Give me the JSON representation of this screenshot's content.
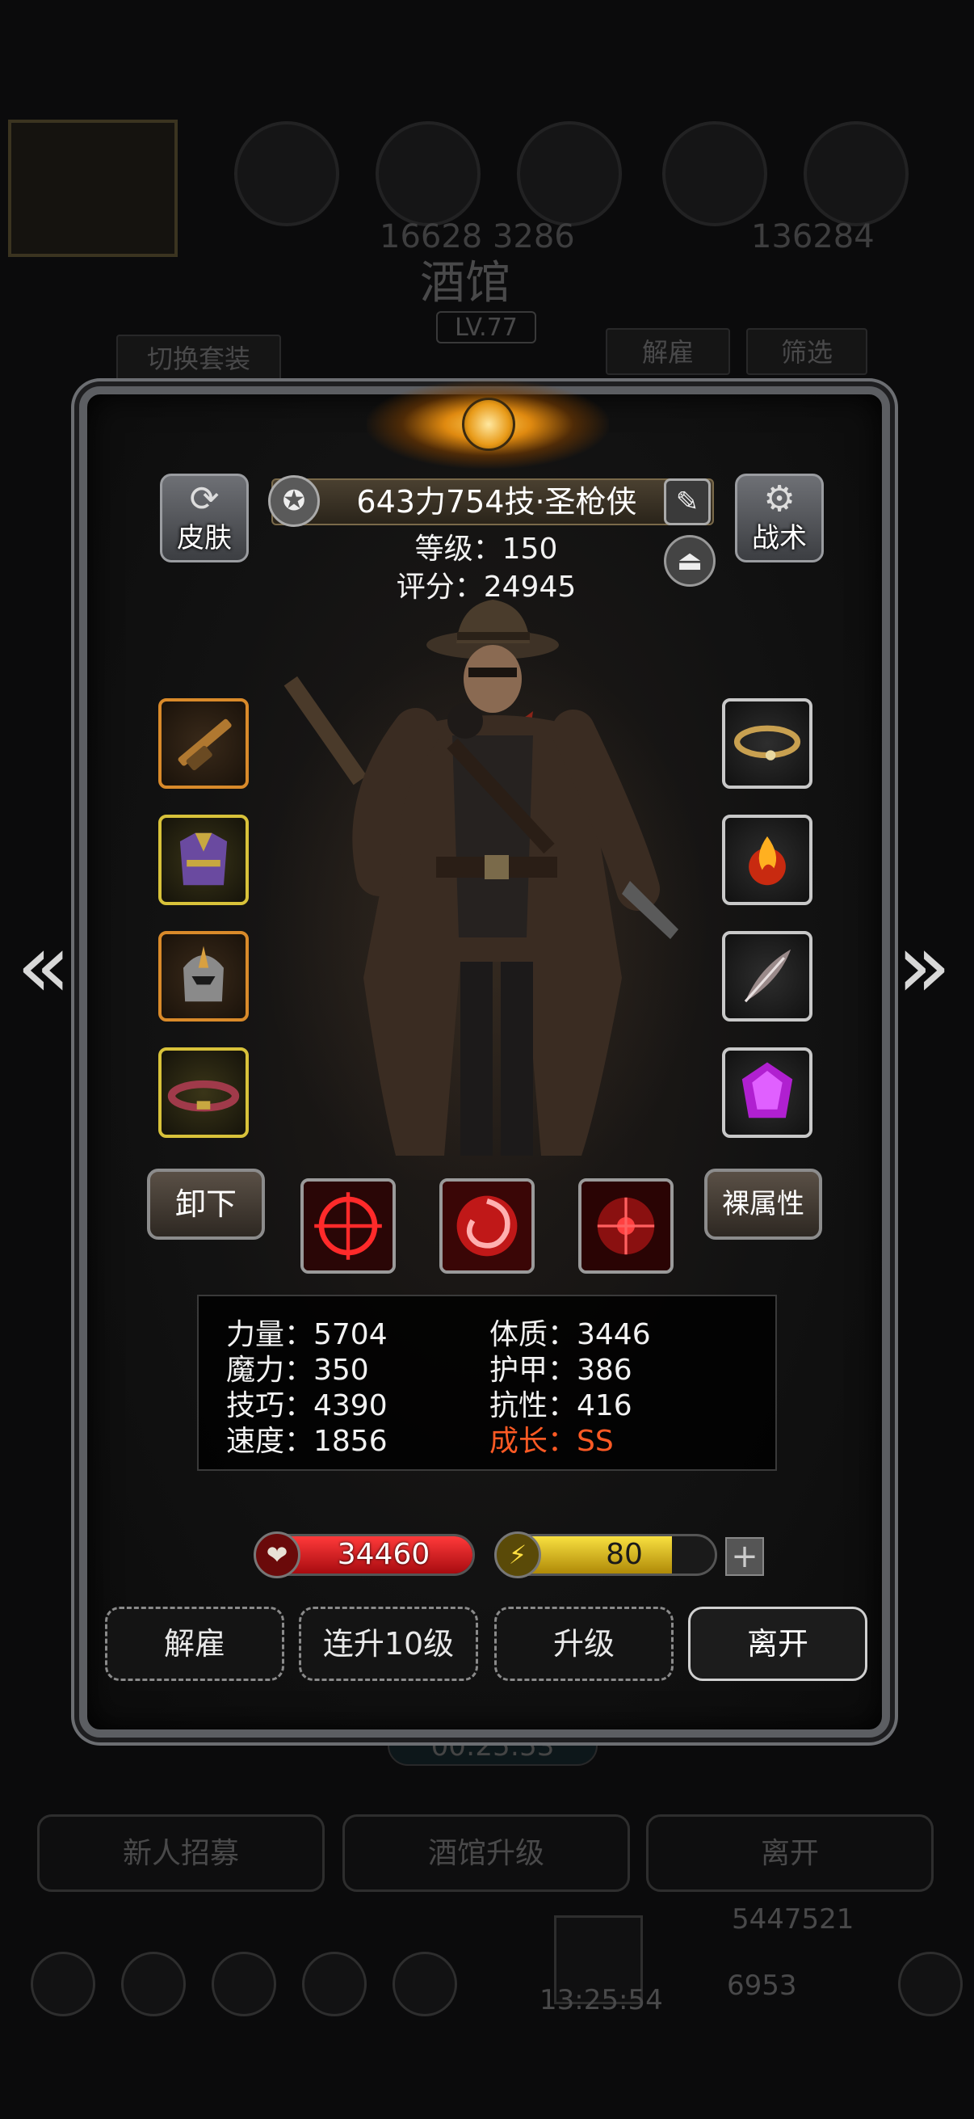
{
  "background": {
    "resource_top_left": "16628  3286",
    "resource_top_right": "136284",
    "title": "酒馆",
    "level": "LV.77",
    "switch_outfit_button": "切换套装",
    "dismiss_button": "解雇",
    "filter_button": "筛选",
    "timer": "00:25:53",
    "new_recruit_button": "新人招募",
    "tavern_upgrade_button": "酒馆升级",
    "leave_button": "离开",
    "gold": "5447521",
    "gems": "6953",
    "bottom_timer": "13:25:54"
  },
  "hero": {
    "name": "643力754技·圣枪侠",
    "level_line": "等级：150",
    "score_line": "评分：24945",
    "skin_button": "皮肤",
    "tactics_button": "战术",
    "unequip_button": "卸下",
    "base_stats_button": "裸属性"
  },
  "stats": {
    "strength": "力量：5704",
    "magic": "魔力：350",
    "skill": "技巧：4390",
    "speed": "速度：1856",
    "constitution": "体质：3446",
    "armor": "护甲：386",
    "resistance": "抗性：416",
    "growth": "成长：SS"
  },
  "bars": {
    "hp_value": "34460",
    "hp_fill": 1.0,
    "energy_value": "80",
    "energy_fill": 0.8
  },
  "actions": {
    "dismiss": "解雇",
    "upgrade_10": "连升10级",
    "upgrade": "升级",
    "leave": "离开"
  },
  "colors": {
    "hp": "#d4141c",
    "energy": "#e0c21a",
    "growth": "#ff5a24"
  },
  "icons": {
    "left_arrow": "chevron-left-icon",
    "right_arrow": "chevron-right-icon",
    "plus": "plus-icon"
  }
}
